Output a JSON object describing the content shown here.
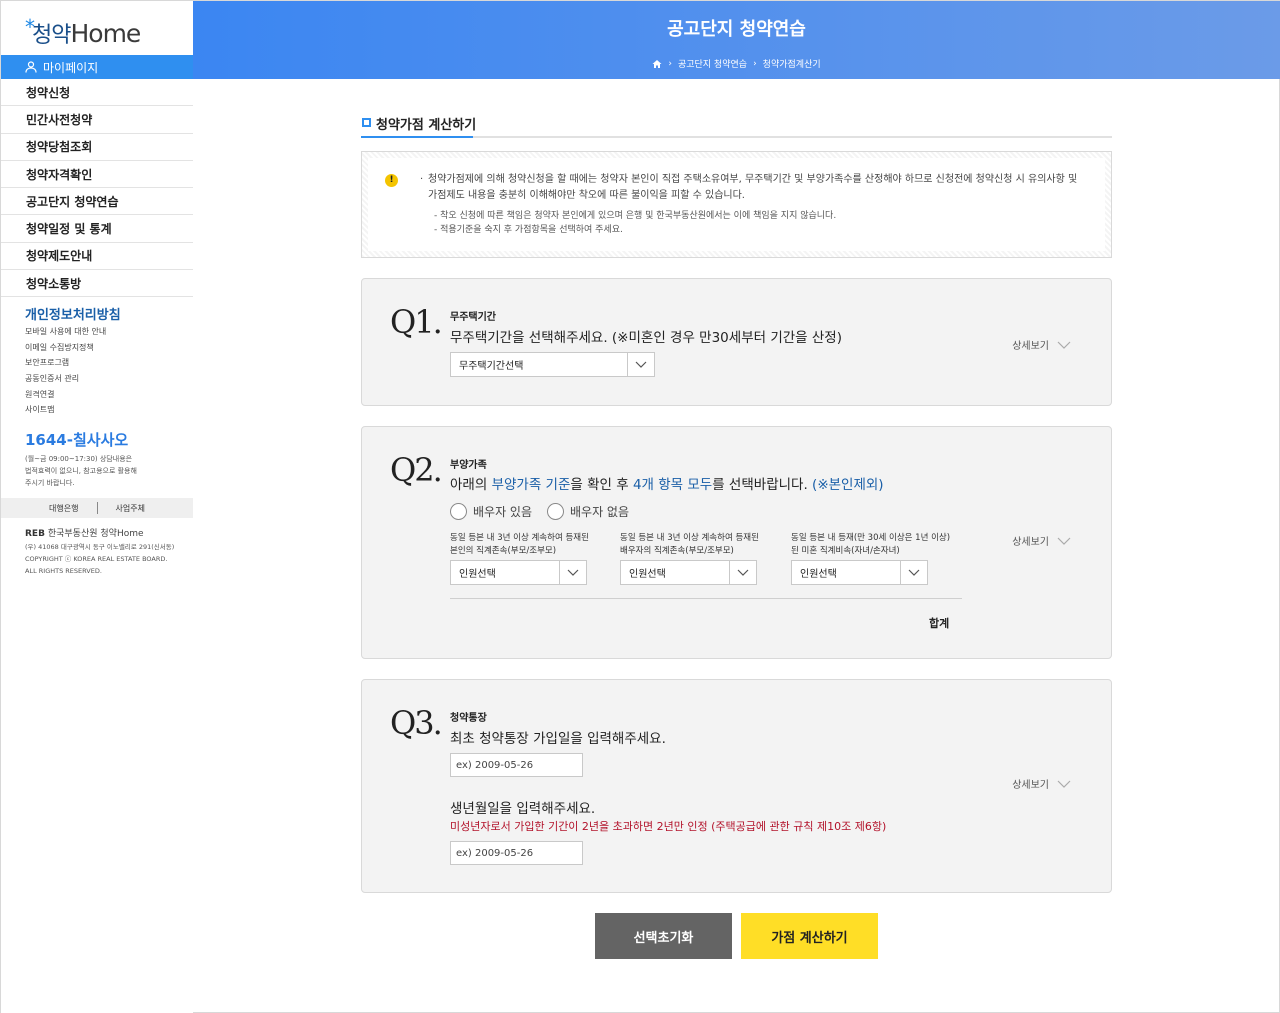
{
  "logo": {
    "star": "*",
    "ko": "청약",
    "en": "Home"
  },
  "sidebar": {
    "mypage": "마이페이지",
    "menu": [
      "청약신청",
      "민간사전청약",
      "청약당첨조회",
      "청약자격확인",
      "공고단지 청약연습",
      "청약일정 및 통계",
      "청약제도안내",
      "청약소통방"
    ],
    "policy_title": "개인정보처리방침",
    "policy_links": [
      "모바일 사용에 대한 안내",
      "이메일 수집방지정책",
      "보안프로그램",
      "공동인증서 관리",
      "원격연결",
      "사이트맵"
    ],
    "call_number": "1644-칠사사오",
    "call_note_1": "(월~금 09:00~17:30) 상담내용은",
    "call_note_2": "법적효력이 없으니, 참고용으로 활용해",
    "call_note_3": "주시기 바랍니다.",
    "link_bank": "대행은행",
    "link_biz": "사업주체",
    "footer_logo_reb": "REB",
    "footer_logo_name": "한국부동산원",
    "footer_logo_home": "청약Home",
    "footer_address": "(우) 41068 대구광역시 동구 이노밸리로 291(신서동)",
    "footer_copyright": "COPYRIGHT ⓒ KOREA REAL ESTATE BOARD.",
    "footer_rights": "ALL RIGHTS RESERVED."
  },
  "header": {
    "title": "공고단지 청약연습",
    "crumb_1": "공고단지 청약연습",
    "crumb_2": "청약가점계산기"
  },
  "section_title": "청약가점 계산하기",
  "notice": {
    "warn": "!",
    "main": "청약가점제에 의해 청약신청을 할 때에는 청약자 본인이 직접 주택소유여부, 무주택기간 및 부양가족수를 산정해야 하므로 신청전에 청약신청 시 유의사항 및 가점제도 내용을 충분히 이해해야만 착오에 따른 불이익을 피할 수 있습니다.",
    "dot": "·",
    "sub_1": "- 착오 신청에 따른 책임은 청약자 본인에게 있으며 은행 및 한국부동산원에서는 이에 책임을 지지 않습니다.",
    "sub_2": "- 적용기준을 숙지 후 가점항목을 선택하여 주세요."
  },
  "q1": {
    "num": "Q1.",
    "label": "무주택기간",
    "text": "무주택기간을 선택해주세요. (※미혼인 경우 만30세부터 기간을 산정)",
    "select": "무주택기간선택",
    "detail": "상세보기"
  },
  "q2": {
    "num": "Q2.",
    "label": "부양가족",
    "text_a": "아래의 ",
    "text_b": "부양가족 기준",
    "text_c": "을 확인 후 ",
    "text_d": "4개 항목 모두",
    "text_e": "를 선택바랍니다. ",
    "text_f": "(※본인제외)",
    "radio_yes": "배우자 있음",
    "radio_no": "배우자 없음",
    "dep1_line1": "동일 등본 내 3년 이상 계속하여 등재된",
    "dep1_line2": "본인의 직계존속(부모/조부모)",
    "dep2_line1": "동일 등본 내 3년 이상 계속하여 등재된",
    "dep2_line2": "배우자의 직계존속(부모/조부모)",
    "dep3_line1": "동일 등본 내 등재(만 30세 이상은 1년 이상)",
    "dep3_line2": "된 미혼 직계비속(자녀/손자녀)",
    "select": "인원선택",
    "total": "합계",
    "detail": "상세보기"
  },
  "q3": {
    "num": "Q3.",
    "label": "청약통장",
    "text": "최초 청약통장 가입일을 입력해주세요.",
    "input_1": "ex) 2009-05-26",
    "text_2": "생년월일을 입력해주세요.",
    "red": "미성년자로서 가입한 기간이 2년을 초과하면 2년만 인정 (주택공급에 관한 규칙 제10조 제6항)",
    "input_2": "ex) 2009-05-26",
    "detail": "상세보기"
  },
  "buttons": {
    "reset": "선택초기화",
    "calc": "가점 계산하기"
  }
}
